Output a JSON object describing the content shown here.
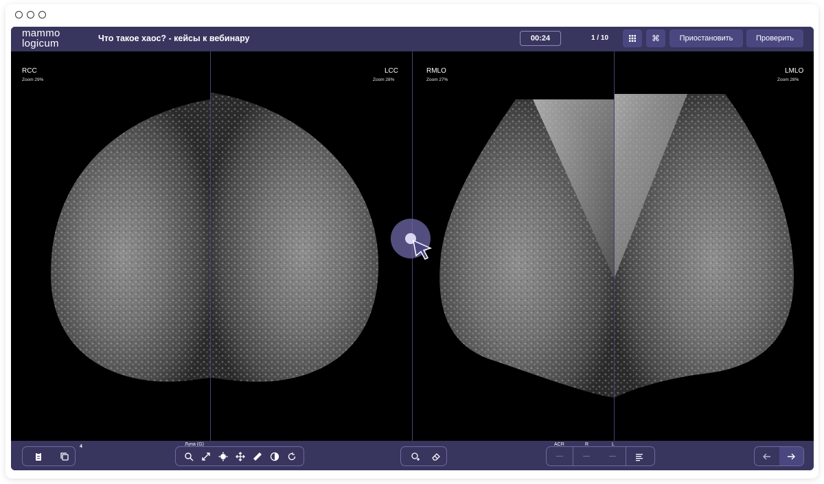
{
  "app": {
    "logo_line1": "mammo",
    "logo_line2": "logicum",
    "title": "Что такое хаос? - кейсы к вебинару",
    "timer": "00:24",
    "counter": "1 / 10",
    "pause_label": "Приостановить",
    "check_label": "Проверить"
  },
  "views": [
    {
      "label": "RCC",
      "zoom": "Zoom 29%"
    },
    {
      "label": "LCC",
      "zoom": "Zoom 28%"
    },
    {
      "label": "RMLO",
      "zoom": "Zoom 27%"
    },
    {
      "label": "LMLO",
      "zoom": "Zoom 28%"
    }
  ],
  "toolbar": {
    "series_count": "4",
    "magnifier_label": "Лупа (G)",
    "acr_label": "ACR",
    "r_label": "R",
    "l_label": "L",
    "acr_value": "—",
    "r_value": "—",
    "l_value": "—"
  },
  "icons": [
    "clipboard-icon",
    "copy-icon",
    "search-icon",
    "expand-icon",
    "brightness-icon",
    "move-icon",
    "ruler-icon",
    "contrast-icon",
    "rotate-icon",
    "add-circle-icon",
    "eraser-icon",
    "report-icon",
    "arrow-left-icon",
    "arrow-right-icon",
    "grid-icon",
    "command-icon"
  ],
  "colors": {
    "bar": "#38355f",
    "button": "#4a4780",
    "divider": "#46447a"
  }
}
